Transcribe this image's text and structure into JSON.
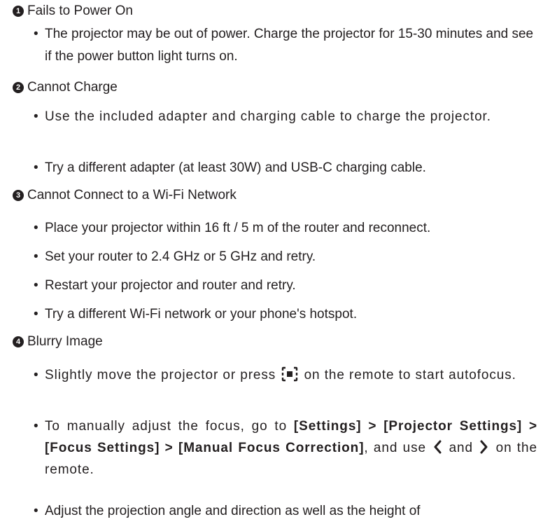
{
  "sections": [
    {
      "number": "1",
      "title": "Fails to Power On",
      "bullets": [
        "The projector may be out of power. Charge the projector for 15-30 minutes and see if the power button light turns on."
      ]
    },
    {
      "number": "2",
      "title": "Cannot Charge",
      "bullets": [
        "Use the included adapter and charging cable to charge the projector.",
        "Try a different adapter (at least 30W) and USB-C charging cable."
      ]
    },
    {
      "number": "3",
      "title": "Cannot Connect to a Wi-Fi Network",
      "bullets": [
        "Place your projector within 16 ft / 5 m of the router and reconnect.",
        "Set your router to 2.4 GHz or 5 GHz and retry.",
        "Restart your projector and router and retry.",
        "Try a different Wi-Fi network or your phone's hotspot."
      ]
    },
    {
      "number": "4",
      "title": "Blurry Image",
      "bullets": [
        {
          "before": "Slightly move the projector or press",
          "icon": "autofocus-icon",
          "after": "on the remote to start autofocus."
        },
        {
          "before": "To manually adjust the focus, go to ",
          "bold": "[Settings] > [Projector Settings] > [Focus Settings] > [Manual Focus Correction]",
          "middle": ", and use",
          "icon_left": "chevron-left-icon",
          "and": "and",
          "icon_right": "chevron-right-icon",
          "after": "on the remote."
        },
        "Adjust the projection angle and direction as well as the height of"
      ]
    }
  ],
  "bullet_symbol": "•",
  "icons": {
    "autofocus-icon": "focus-frame-with-square",
    "chevron-left-icon": "chevron-left",
    "chevron-right-icon": "chevron-right"
  },
  "colors": {
    "text": "#231f20",
    "number_badge": "#231f20",
    "background": "#ffffff"
  }
}
